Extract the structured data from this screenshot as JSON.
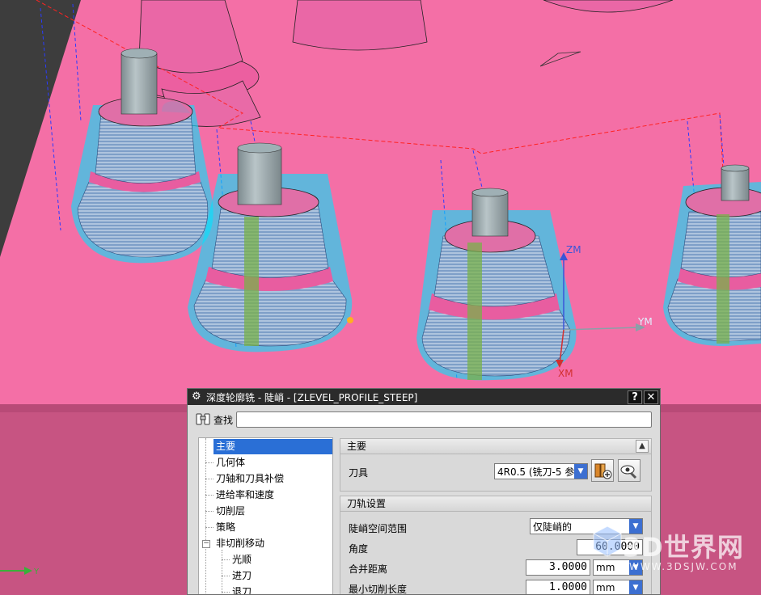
{
  "viewport": {
    "axes": {
      "zm": "ZM",
      "ym": "YM",
      "xm": "XM",
      "y": "Y"
    },
    "colors": {
      "background": "#3d3d3d",
      "table": "#f46fa6",
      "table_side": "#c9577f",
      "part": "#e86aa4",
      "toolpath": "#00e5ff",
      "engage": "#ffb020",
      "stock_line": "#ff2222",
      "tool": "#9aa7ab"
    }
  },
  "dialog": {
    "title": "深度轮廓铣 - 陡峭 - [ZLEVEL_PROFILE_STEEP]",
    "help_button": "?",
    "close_button": "✕",
    "search_label": "查找",
    "search_value": "",
    "nav": [
      {
        "label": "主要",
        "selected": true
      },
      {
        "label": "几何体"
      },
      {
        "label": "刀轴和刀具补偿"
      },
      {
        "label": "进给率和速度"
      },
      {
        "label": "切削层"
      },
      {
        "label": "策略"
      },
      {
        "label": "非切削移动",
        "expanded": true
      },
      {
        "label": "光顺",
        "child": true
      },
      {
        "label": "进刀",
        "child": true
      },
      {
        "label": "退刀",
        "child": true
      }
    ],
    "sections": {
      "main": {
        "title": "主要",
        "tool_label": "刀具",
        "tool_value": "4R0.5 (铣刀-5 参"
      },
      "path": {
        "title": "刀轨设置",
        "steep_range_label": "陡峭空间范围",
        "steep_range_value": "仅陡峭的",
        "angle_label": "角度",
        "angle_value": "60.0000",
        "merge_label": "合并距离",
        "merge_value": "3.0000",
        "merge_unit": "mm",
        "min_cut_label": "最小切削长度",
        "min_cut_value": "1.0000",
        "min_cut_unit": "mm"
      }
    }
  },
  "watermark": {
    "brand": "3D世界网",
    "url": "WWW.3DSJW.COM"
  }
}
